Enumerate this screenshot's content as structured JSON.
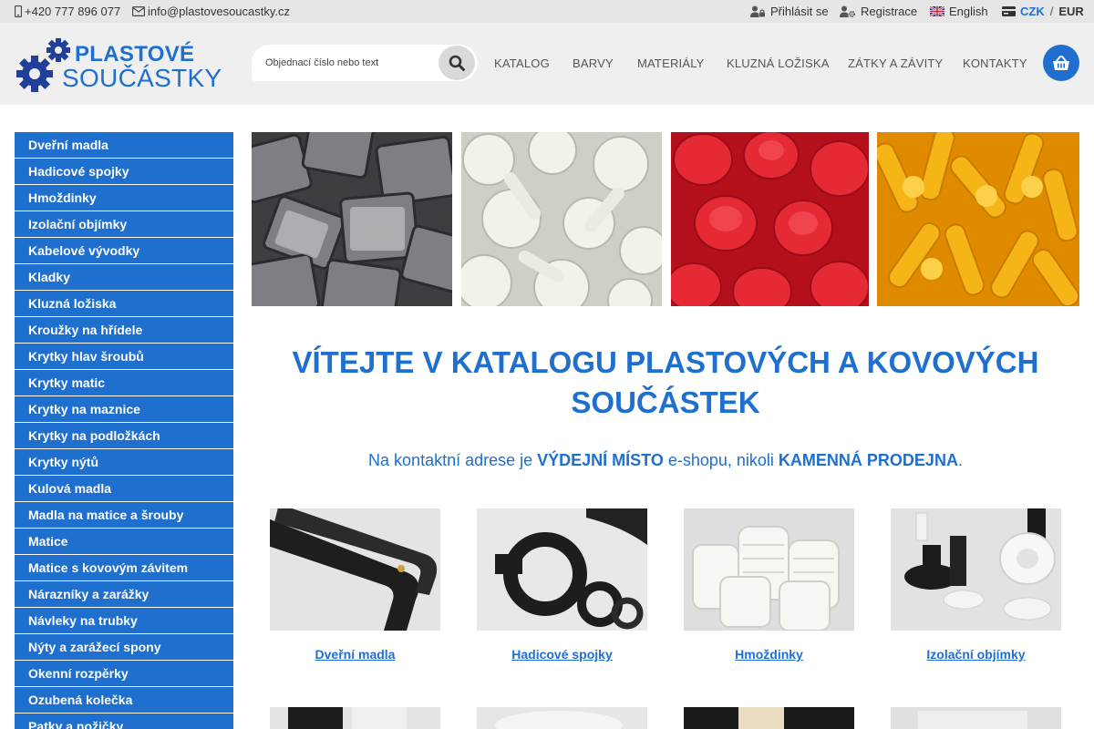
{
  "topbar": {
    "phone": "+420 777 896 077",
    "email": "info@plastovesoucastky.cz",
    "login": "Přihlásit se",
    "register": "Registrace",
    "language": "English",
    "currency_active": "CZK",
    "currency_separator": "/",
    "currency_other": "EUR"
  },
  "header": {
    "logo_line1": "PLASTOVÉ",
    "logo_line2": "SOUČÁSTKY",
    "search_placeholder": "Objednací číslo nebo text",
    "nav": [
      "KATALOG",
      "BARVY",
      "MATERIÁLY",
      "KLUZNÁ LOŽISKA",
      "ZÁTKY A ZÁVITY",
      "KONTAKTY"
    ]
  },
  "sidebar": {
    "items": [
      "Dveřní madla",
      "Hadicové spojky",
      "Hmoždinky",
      "Izolační objímky",
      "Kabelové vývodky",
      "Kladky",
      "Kluzná ložiska",
      "Kroužky na hřídele",
      "Krytky hlav šroubů",
      "Krytky matic",
      "Krytky na maznice",
      "Krytky na podložkách",
      "Krytky nýtů",
      "Kulová madla",
      "Madla na matice a šrouby",
      "Matice",
      "Matice s kovovým závitem",
      "Nárazníky a zarážky",
      "Návleky na trubky",
      "Nýty a zarážecí spony",
      "Okenní rozpěrky",
      "Ozubená kolečka",
      "Patky a nožičky"
    ]
  },
  "main": {
    "title": "VÍTEJTE V KATALOGU PLASTOVÝCH A KOVOVÝCH SOUČÁSTEK",
    "subtitle_part1": "Na kontaktní adrese je ",
    "subtitle_bold1": "VÝDEJNÍ MÍSTO",
    "subtitle_part2": " e-shopu, nikoli ",
    "subtitle_bold2": "KAMENNÁ PRODEJNA",
    "subtitle_part3": ".",
    "categories": [
      "Dveřní madla",
      "Hadicové spojky",
      "Hmoždinky",
      "Izolační objímky"
    ]
  },
  "colors": {
    "accent": "#1f6fcf",
    "topbar_bg": "#e6e6e6",
    "header_bg": "#efefef"
  }
}
